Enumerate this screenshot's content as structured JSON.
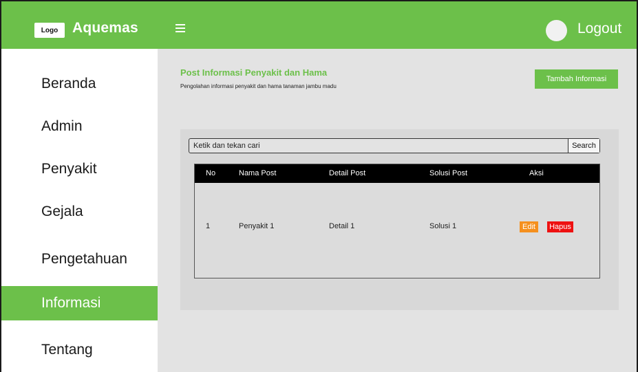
{
  "header": {
    "logo_text": "Logo",
    "brand": "Aquemas",
    "logout": "Logout",
    "accent_color": "#6cc04a"
  },
  "sidebar": {
    "items": [
      {
        "label": "Beranda",
        "active": false
      },
      {
        "label": "Admin",
        "active": false
      },
      {
        "label": "Penyakit",
        "active": false
      },
      {
        "label": "Gejala",
        "active": false
      },
      {
        "label": "Pengetahuan",
        "active": false
      },
      {
        "label": "Informasi",
        "active": true
      },
      {
        "label": "Tentang",
        "active": false
      }
    ]
  },
  "main": {
    "title": "Post Informasi Penyakit dan Hama",
    "subtitle": "Pengolahan informasi penyakit dan hama tanaman jambu madu",
    "add_button": "Tambah Informasi",
    "search": {
      "value": "",
      "placeholder": "Ketik dan tekan cari",
      "button": "Search"
    },
    "table": {
      "columns": [
        "No",
        "Nama Post",
        "Detail Post",
        "Solusi Post",
        "Aksi"
      ],
      "rows": [
        {
          "no": "1",
          "nama": "Penyakit 1",
          "detail": "Detail 1",
          "solusi": "Solusi 1",
          "edit": "Edit",
          "hapus": "Hapus"
        }
      ]
    }
  },
  "icons": {
    "menu": "hamburger-menu-icon",
    "avatar": "user-avatar-icon"
  },
  "colors": {
    "edit": "#f5901e",
    "delete": "#ee1111",
    "table_header": "#000000"
  }
}
